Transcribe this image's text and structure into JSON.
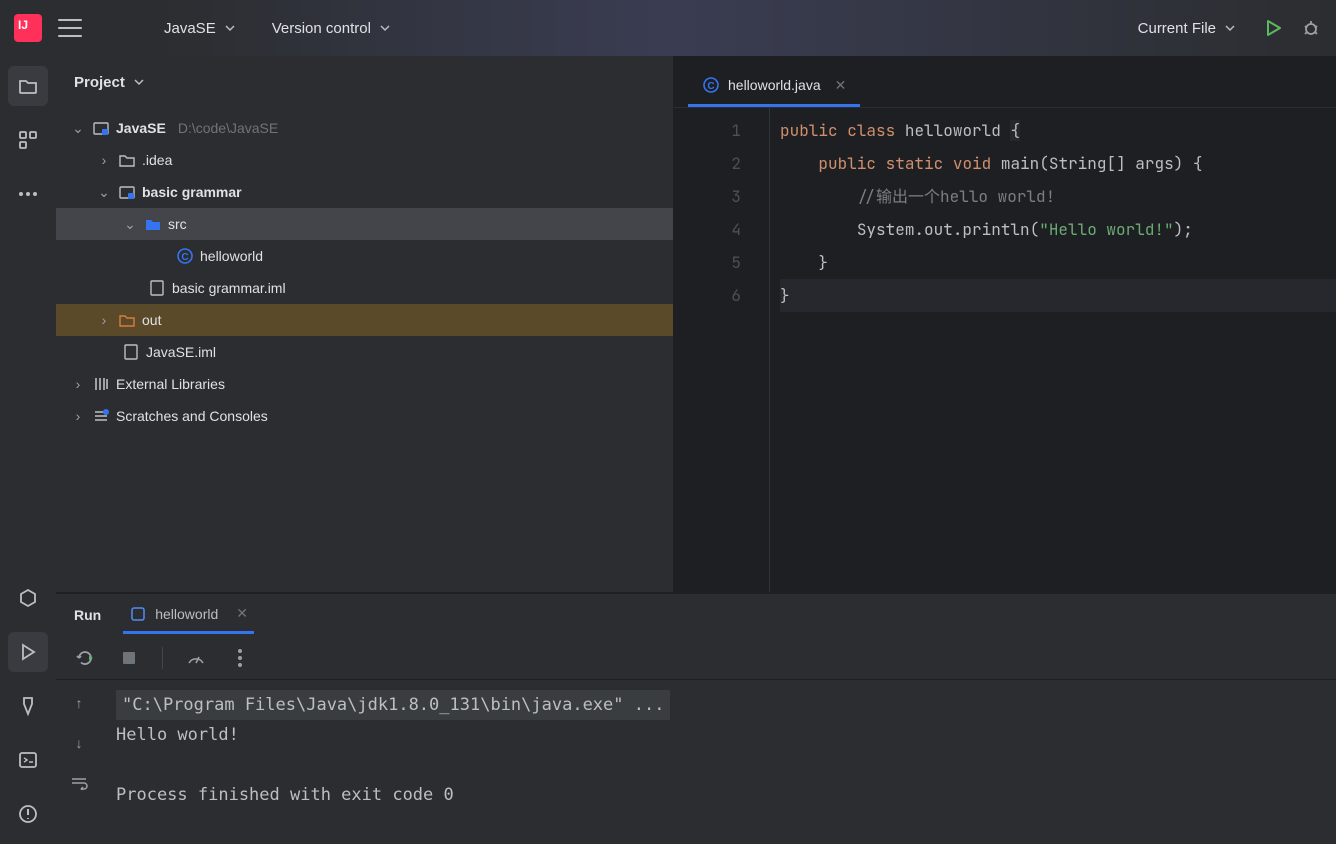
{
  "topbar": {
    "project_menu": "JavaSE",
    "vcs_menu": "Version control",
    "run_config": "Current File"
  },
  "project": {
    "panel_title": "Project",
    "root_name": "JavaSE",
    "root_path": "D:\\code\\JavaSE",
    "idea_folder": ".idea",
    "module_name": "basic grammar",
    "src_folder": "src",
    "class_file": "helloworld",
    "iml_file": "basic grammar.iml",
    "out_folder": "out",
    "project_iml": "JavaSE.iml",
    "ext_libs": "External Libraries",
    "scratches": "Scratches and Consoles"
  },
  "editor": {
    "tab_name": "helloworld.java",
    "lines": [
      "1",
      "2",
      "3",
      "4",
      "5",
      "6"
    ],
    "code": {
      "l1_kw1": "public",
      "l1_kw2": "class",
      "l1_cls": "helloworld",
      "l1_br": "{",
      "l2_kw1": "public",
      "l2_kw2": "static",
      "l2_kw3": "void",
      "l2_fn": "main",
      "l2_rest": "(String[] args) {",
      "l3": "//输出一个hello world!",
      "l4_a": "System.out.println(",
      "l4_str": "\"Hello world!\"",
      "l4_b": ");",
      "l5": "}",
      "l6": "}"
    }
  },
  "run": {
    "title": "Run",
    "tab": "helloworld",
    "cmd": "\"C:\\Program Files\\Java\\jdk1.8.0_131\\bin\\java.exe\" ...",
    "out": "Hello world!",
    "exit": "Process finished with exit code 0"
  }
}
